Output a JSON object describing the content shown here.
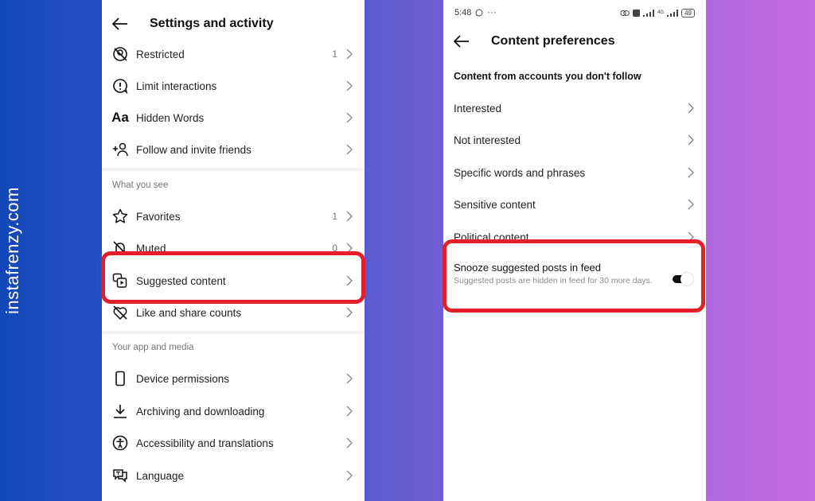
{
  "watermark": "instafrenzy.com",
  "colors": {
    "highlight": "#e3202a",
    "background_start": "#1347b8",
    "background_end": "#c46ae2"
  },
  "left_screen": {
    "header": {
      "title": "Settings and activity",
      "back_icon": "arrow-left-icon"
    },
    "rows_top": [
      {
        "label": "Restricted",
        "count": "1",
        "icon": "restricted-icon"
      },
      {
        "label": "Limit interactions",
        "count": "",
        "icon": "limit-interactions-icon"
      },
      {
        "label": "Hidden Words",
        "count": "",
        "icon": "hidden-words-icon"
      },
      {
        "label": "Follow and invite friends",
        "count": "",
        "icon": "add-person-icon"
      }
    ],
    "section_what_you_see": {
      "label": "What you see",
      "rows": [
        {
          "label": "Favorites",
          "count": "1",
          "icon": "star-icon"
        },
        {
          "label": "Muted",
          "count": "0",
          "icon": "muted-icon"
        },
        {
          "label": "Suggested content",
          "count": "",
          "icon": "suggested-content-icon",
          "highlighted": true
        },
        {
          "label": "Like and share counts",
          "count": "",
          "icon": "heart-off-icon"
        }
      ]
    },
    "section_app_media": {
      "label": "Your app and media",
      "rows": [
        {
          "label": "Device permissions",
          "icon": "phone-icon"
        },
        {
          "label": "Archiving and downloading",
          "icon": "download-icon"
        },
        {
          "label": "Accessibility and translations",
          "icon": "accessibility-icon"
        },
        {
          "label": "Language",
          "icon": "language-icon"
        }
      ]
    }
  },
  "right_screen": {
    "status_bar": {
      "time": "5:48",
      "extra": "···",
      "battery": "49",
      "network": "4G"
    },
    "header": {
      "title": "Content preferences",
      "back_icon": "arrow-left-icon"
    },
    "subheading": "Content from accounts you don't follow",
    "rows": [
      {
        "label": "Interested"
      },
      {
        "label": "Not interested"
      },
      {
        "label": "Specific words and phrases"
      },
      {
        "label": "Sensitive content"
      },
      {
        "label": "Political content"
      }
    ],
    "snooze": {
      "title": "Snooze suggested posts in feed",
      "description": "Suggested posts are hidden in feed for 30 more days.",
      "toggle_on": true,
      "highlighted": true
    }
  }
}
